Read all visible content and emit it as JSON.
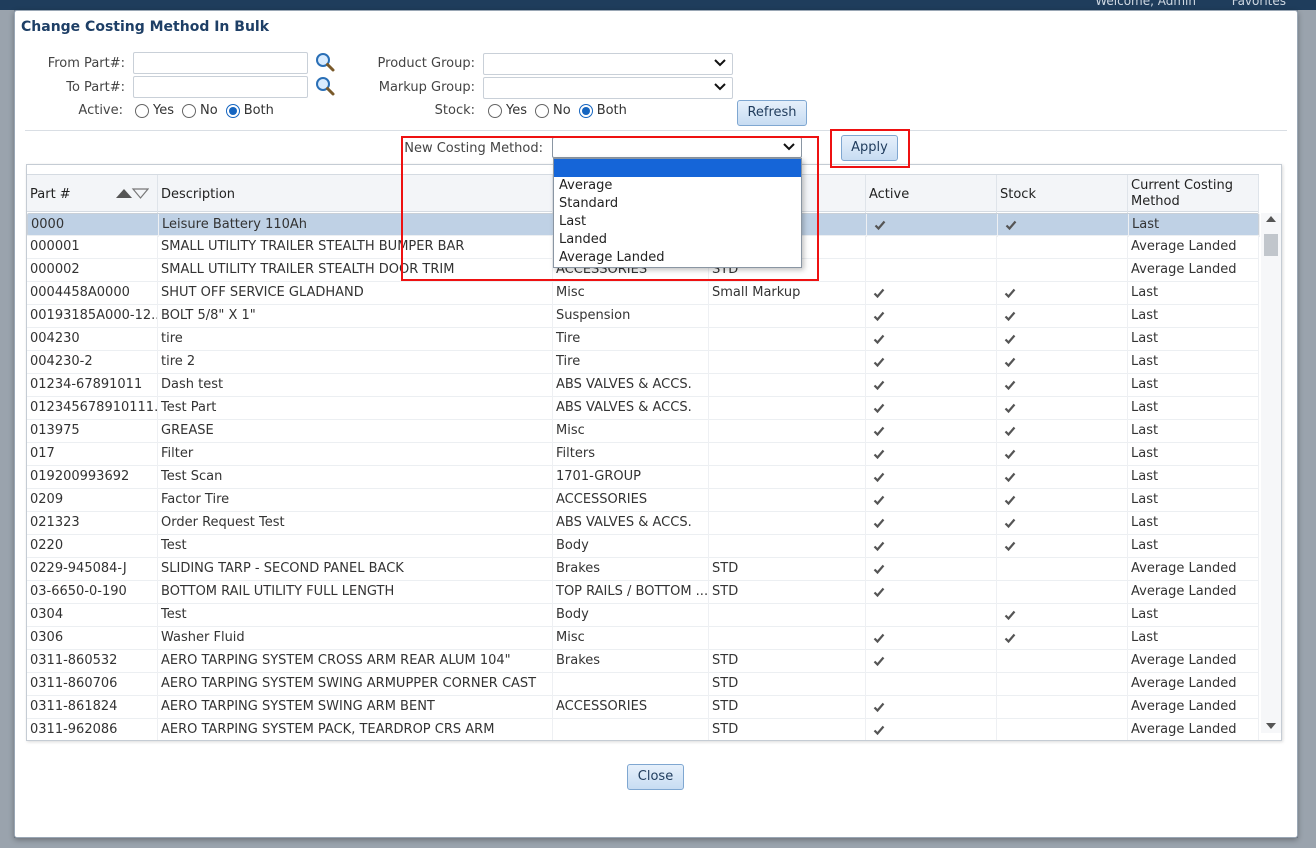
{
  "background": {
    "welcome": "Welcome, Admin",
    "favorites": "Favorites"
  },
  "modal": {
    "title": "Change Costing Method In Bulk"
  },
  "filters": {
    "from_part_label": "From Part#:",
    "to_part_label": "To Part#:",
    "active_label": "Active:",
    "product_group_label": "Product Group:",
    "markup_group_label": "Markup Group:",
    "stock_label": "Stock:",
    "radio_yes": "Yes",
    "radio_no": "No",
    "radio_both": "Both",
    "active_selected": "Both",
    "stock_selected": "Both",
    "refresh_label": "Refresh"
  },
  "costing": {
    "new_costing_label": "New Costing Method:",
    "apply_label": "Apply",
    "options": [
      "",
      "Average",
      "Standard",
      "Last",
      "Landed",
      "Average Landed"
    ],
    "highlighted_index": 0
  },
  "grid": {
    "headers": {
      "part": "Part #",
      "description": "Description",
      "active": "Active",
      "stock": "Stock",
      "current_costing": "Current Costing Method"
    },
    "rows": [
      {
        "part": "0000",
        "desc": "Leisure Battery 110Ah",
        "group": "",
        "markup": "",
        "active": true,
        "stock": true,
        "method": "Last"
      },
      {
        "part": "000001",
        "desc": "SMALL UTILITY TRAILER STEALTH BUMPER BAR",
        "group": "",
        "markup": "",
        "active": false,
        "stock": false,
        "method": "Average Landed"
      },
      {
        "part": "000002",
        "desc": "SMALL UTILITY TRAILER STEALTH DOOR TRIM",
        "group": "ACCESSORIES",
        "markup": "STD",
        "active": false,
        "stock": false,
        "method": "Average Landed"
      },
      {
        "part": "0004458A0000",
        "desc": "SHUT OFF SERVICE GLADHAND",
        "group": "Misc",
        "markup": "Small Markup",
        "active": true,
        "stock": true,
        "method": "Last"
      },
      {
        "part": "00193185A000-12...",
        "desc": "BOLT 5/8\" X 1\"",
        "group": "Suspension",
        "markup": "",
        "active": true,
        "stock": true,
        "method": "Last"
      },
      {
        "part": "004230",
        "desc": "tire",
        "group": "Tire",
        "markup": "",
        "active": true,
        "stock": true,
        "method": "Last"
      },
      {
        "part": "004230-2",
        "desc": "tire 2",
        "group": "Tire",
        "markup": "",
        "active": true,
        "stock": true,
        "method": "Last"
      },
      {
        "part": "01234-67891011",
        "desc": "Dash test",
        "group": "ABS VALVES & ACCS.",
        "markup": "",
        "active": true,
        "stock": true,
        "method": "Last"
      },
      {
        "part": "012345678910111...",
        "desc": "Test Part",
        "group": "ABS VALVES & ACCS.",
        "markup": "",
        "active": true,
        "stock": true,
        "method": "Last"
      },
      {
        "part": "013975",
        "desc": "GREASE",
        "group": "Misc",
        "markup": "",
        "active": true,
        "stock": true,
        "method": "Last"
      },
      {
        "part": "017",
        "desc": "Filter",
        "group": "Filters",
        "markup": "",
        "active": true,
        "stock": true,
        "method": "Last"
      },
      {
        "part": "019200993692",
        "desc": "Test Scan",
        "group": "1701-GROUP",
        "markup": "",
        "active": true,
        "stock": true,
        "method": "Last"
      },
      {
        "part": "0209",
        "desc": "Factor Tire",
        "group": "ACCESSORIES",
        "markup": "",
        "active": true,
        "stock": true,
        "method": "Last"
      },
      {
        "part": "021323",
        "desc": "Order Request Test",
        "group": "ABS VALVES & ACCS.",
        "markup": "",
        "active": true,
        "stock": true,
        "method": "Last"
      },
      {
        "part": "0220",
        "desc": "Test",
        "group": "Body",
        "markup": "",
        "active": true,
        "stock": true,
        "method": "Last"
      },
      {
        "part": "0229-945084-J",
        "desc": "SLIDING TARP - SECOND PANEL BACK",
        "group": "Brakes",
        "markup": "STD",
        "active": true,
        "stock": false,
        "method": "Average Landed"
      },
      {
        "part": "03-6650-0-190",
        "desc": "BOTTOM RAIL UTILITY FULL LENGTH",
        "group": "TOP RAILS / BOTTOM ...",
        "markup": "STD",
        "active": true,
        "stock": false,
        "method": "Average Landed"
      },
      {
        "part": "0304",
        "desc": "Test",
        "group": "Body",
        "markup": "",
        "active": false,
        "stock": true,
        "method": "Last"
      },
      {
        "part": "0306",
        "desc": "Washer Fluid",
        "group": "Misc",
        "markup": "",
        "active": true,
        "stock": true,
        "method": "Last"
      },
      {
        "part": "0311-860532",
        "desc": "AERO TARPING SYSTEM CROSS ARM REAR ALUM 104\"",
        "group": "Brakes",
        "markup": "STD",
        "active": true,
        "stock": false,
        "method": "Average Landed"
      },
      {
        "part": "0311-860706",
        "desc": "AERO TARPING SYSTEM SWING ARMUPPER CORNER CAST",
        "group": "",
        "markup": "STD",
        "active": false,
        "stock": false,
        "method": "Average Landed"
      },
      {
        "part": "0311-861824",
        "desc": "AERO TARPING SYSTEM SWING ARM BENT",
        "group": "ACCESSORIES",
        "markup": "STD",
        "active": true,
        "stock": false,
        "method": "Average Landed"
      },
      {
        "part": "0311-962086",
        "desc": "AERO TARPING SYSTEM PACK, TEARDROP CRS ARM",
        "group": "",
        "markup": "STD",
        "active": true,
        "stock": false,
        "method": "Average Landed"
      }
    ],
    "selected_row_index": 0
  },
  "footer": {
    "close_label": "Close"
  },
  "colors": {
    "accent": "#1565d8",
    "highlight_box": "#e11111",
    "title": "#1e3f66",
    "selected_row": "#bfd1e5"
  }
}
